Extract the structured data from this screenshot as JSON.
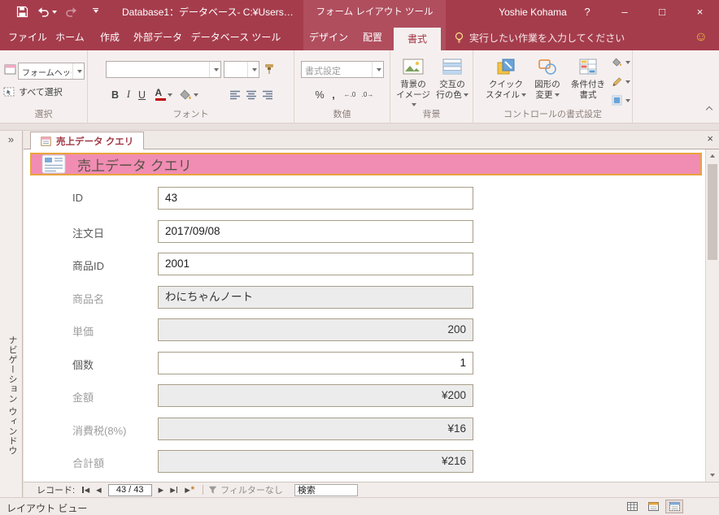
{
  "titlebar": {
    "title": "Database1：データベース- C:¥Users…",
    "contextual_title": "フォーム レイアウト ツール",
    "user_name": "Yoshie Kohama",
    "help_glyph": "?",
    "minimize_glyph": "–",
    "maximize_glyph": "□",
    "close_glyph": "×"
  },
  "ribbon": {
    "tabs": [
      {
        "label": "ファイル"
      },
      {
        "label": "ホーム"
      },
      {
        "label": "作成"
      },
      {
        "label": "外部データ"
      },
      {
        "label": "データベース ツール"
      },
      {
        "label": "デザイン"
      },
      {
        "label": "配置"
      },
      {
        "label": "書式"
      }
    ],
    "active_tab": "書式",
    "tell_me": "実行したい作業を入力してください",
    "feedback_glyph": "☺",
    "selection": {
      "group_label": "選択",
      "object_selector_value": "フォームヘッダー",
      "select_all_label": "すべて選択"
    },
    "font": {
      "group_label": "フォント",
      "bold": "B",
      "italic": "I",
      "underline": "U",
      "font_color_letter": "A"
    },
    "number": {
      "group_label": "数値",
      "format_placeholder": "書式設定",
      "percent": "%",
      "comma": ",",
      "increase_decimal": "←.0",
      "decrease_decimal": ".0→"
    },
    "background": {
      "group_label": "背景",
      "background_image_label": "背景の\nイメージ",
      "alternate_row_label": "交互の\n行の色"
    },
    "control_formatting": {
      "group_label": "コントロールの書式設定",
      "quick_styles_label": "クイック\nスタイル",
      "change_shape_label": "図形の\n変更",
      "conditional_label": "条件付き\n書式"
    }
  },
  "workspace": {
    "document_tab": "売上データ クエリ",
    "close_glyph": "×",
    "nav_pane_title": "ナビゲーション ウィンドウ",
    "nav_pane_expand_glyph": "»"
  },
  "form": {
    "header_title": "売上データ クエリ",
    "fields": [
      {
        "label": "ID",
        "value": "43"
      },
      {
        "label": "注文日",
        "value": "2017/09/08"
      },
      {
        "label": "商品ID",
        "value": "2001"
      },
      {
        "label": "商品名",
        "value": "わにちゃんノート"
      },
      {
        "label": "単価",
        "value": "200"
      },
      {
        "label": "個数",
        "value": "1"
      },
      {
        "label": "金額",
        "value": "¥200"
      },
      {
        "label": "消費税(8%)",
        "value": "¥16"
      },
      {
        "label": "合計額",
        "value": "¥216"
      }
    ]
  },
  "record_nav": {
    "label": "レコード:",
    "first_glyph": "◀",
    "prev_glyph": "◀",
    "position": "43 / 43",
    "next_glyph": "▶",
    "last_glyph": "▶",
    "new_glyph": "▶",
    "new_star": "*",
    "filter_label": "フィルターなし",
    "search_value": "検索"
  },
  "statusbar": {
    "view_label": "レイアウト ビュー"
  }
}
